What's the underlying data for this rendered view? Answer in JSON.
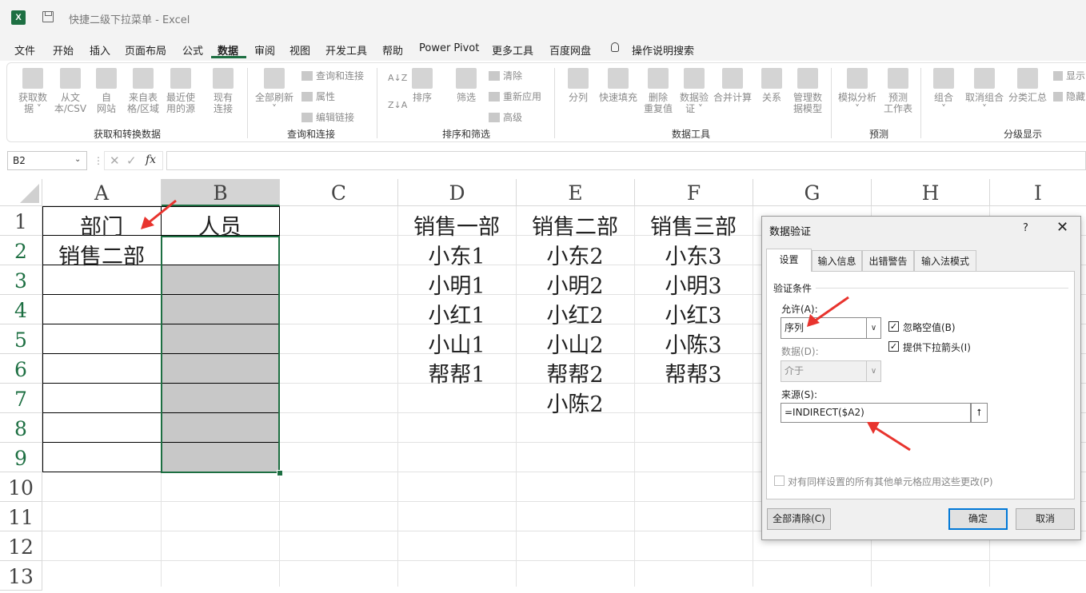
{
  "window": {
    "title": "快捷二级下拉菜单  -  Excel",
    "app_icon": "X"
  },
  "menu_tabs": [
    "文件",
    "开始",
    "插入",
    "页面布局",
    "公式",
    "数据",
    "审阅",
    "视图",
    "开发工具",
    "帮助",
    "Power Pivot",
    "更多工具",
    "百度网盘"
  ],
  "active_tab": "数据",
  "tell_me": "操作说明搜索",
  "ribbon": {
    "get_data": {
      "label": "获取和转换数据",
      "buttons": [
        {
          "l1": "获取数",
          "l2": "据 ˅"
        },
        {
          "l1": "从文",
          "l2": "本/CSV"
        },
        {
          "l1": "自",
          "l2": "网站"
        },
        {
          "l1": "来自表",
          "l2": "格/区域"
        },
        {
          "l1": "最近使",
          "l2": "用的源"
        },
        {
          "l1": "现有",
          "l2": "连接"
        }
      ]
    },
    "queries": {
      "label": "查询和连接",
      "refresh_l1": "全部刷新",
      "refresh_l2": "˅",
      "small": [
        "查询和连接",
        "属性",
        "编辑链接"
      ]
    },
    "sort_filter": {
      "label": "排序和筛选",
      "sort": "排序",
      "filter": "筛选",
      "small": [
        "清除",
        "重新应用",
        "高级"
      ]
    },
    "data_tools": {
      "label": "数据工具",
      "buttons": [
        {
          "l1": "分列",
          "l2": ""
        },
        {
          "l1": "快速填充",
          "l2": ""
        },
        {
          "l1": "删除",
          "l2": "重复值"
        },
        {
          "l1": "数据验",
          "l2": "证 ˅"
        },
        {
          "l1": "合并计算",
          "l2": ""
        },
        {
          "l1": "关系",
          "l2": ""
        },
        {
          "l1": "管理数",
          "l2": "据模型"
        }
      ]
    },
    "forecast": {
      "label": "预测",
      "buttons": [
        {
          "l1": "模拟分析",
          "l2": "˅"
        },
        {
          "l1": "预测",
          "l2": "工作表"
        }
      ]
    },
    "outline": {
      "label": "分级显示",
      "buttons": [
        {
          "l1": "组合",
          "l2": "˅"
        },
        {
          "l1": "取消组合",
          "l2": "˅"
        },
        {
          "l1": "分类汇总",
          "l2": ""
        }
      ],
      "small": [
        "显示",
        "隐藏"
      ]
    }
  },
  "formula_bar": {
    "name_box": "B2",
    "fx": "fx",
    "formula": ""
  },
  "columns": [
    "A",
    "B",
    "C",
    "D",
    "E",
    "F",
    "G",
    "H",
    "I"
  ],
  "rows": [
    "1",
    "2",
    "3",
    "4",
    "5",
    "6",
    "7",
    "8",
    "9",
    "10",
    "11",
    "12",
    "13"
  ],
  "cells": {
    "A1": "部门",
    "B1": "人员",
    "A2": "销售二部",
    "D1": "销售一部",
    "E1": "销售二部",
    "F1": "销售三部",
    "D": [
      "小东1",
      "小明1",
      "小红1",
      "小山1",
      "帮帮1"
    ],
    "E": [
      "小东2",
      "小明2",
      "小红2",
      "小山2",
      "帮帮2",
      "小陈2"
    ],
    "F": [
      "小东3",
      "小明3",
      "小红3",
      "小陈3",
      "帮帮3"
    ]
  },
  "dialog": {
    "title": "数据验证",
    "help": "?",
    "close": "✕",
    "tabs": [
      "设置",
      "输入信息",
      "出错警告",
      "输入法模式"
    ],
    "group_title": "验证条件",
    "allow_label": "允许(A):",
    "allow_value": "序列",
    "data_label": "数据(D):",
    "data_value": "介于",
    "ignore_blank": "忽略空值(B)",
    "dropdown_arrow": "提供下拉箭头(I)",
    "source_label": "来源(S):",
    "source_value": "=INDIRECT($A2)",
    "apply_all": "对有同样设置的所有其他单元格应用这些更改(P)",
    "clear_all": "全部清除(C)",
    "ok": "确定",
    "cancel": "取消"
  },
  "colors": {
    "excel_green": "#1d6f42",
    "annotation_red": "#e8342e",
    "dialog_blue": "#0078d7"
  }
}
